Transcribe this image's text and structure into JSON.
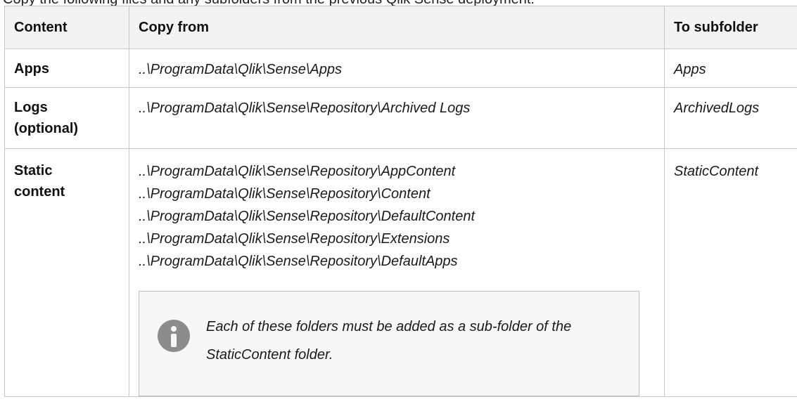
{
  "intro": "Copy the following files and any subfolders from the previous Qlik Sense deployment:",
  "table": {
    "headers": {
      "content": "Content",
      "copy_from": "Copy from",
      "to_subfolder": "To subfolder"
    },
    "rows": [
      {
        "content": "Apps",
        "paths": [
          "..\\ProgramData\\Qlik\\Sense\\Apps"
        ],
        "subfolder": "Apps"
      },
      {
        "content_lines": [
          "Logs",
          "(optional)"
        ],
        "paths": [
          "..\\ProgramData\\Qlik\\Sense\\Repository\\Archived Logs"
        ],
        "subfolder": "ArchivedLogs"
      },
      {
        "content_lines": [
          "Static",
          "content"
        ],
        "paths": [
          "..\\ProgramData\\Qlik\\Sense\\Repository\\AppContent",
          "..\\ProgramData\\Qlik\\Sense\\Repository\\Content",
          "..\\ProgramData\\Qlik\\Sense\\Repository\\DefaultContent",
          "..\\ProgramData\\Qlik\\Sense\\Repository\\Extensions",
          "..\\ProgramData\\Qlik\\Sense\\Repository\\DefaultApps"
        ],
        "subfolder": "StaticContent",
        "note": {
          "icon": "info-icon",
          "text": "Each of these folders must be added as a sub-folder of the StaticContent folder."
        }
      }
    ]
  }
}
